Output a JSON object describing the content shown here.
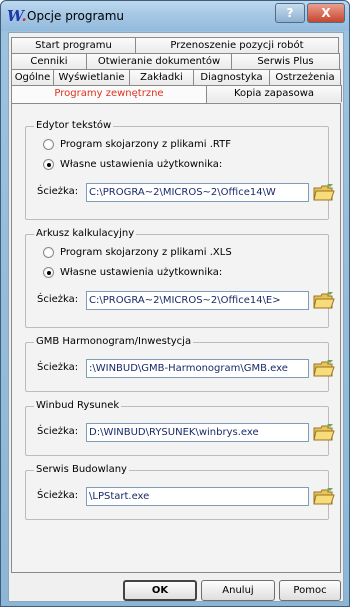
{
  "window": {
    "title": "Opcje programu",
    "help_glyph": "?",
    "close_glyph": "X"
  },
  "tabs": {
    "row1": [
      "Start programu",
      "Przenoszenie pozycji robót"
    ],
    "row2": [
      "Cenniki",
      "Otwieranie dokumentów",
      "Serwis Plus"
    ],
    "row3": [
      "Ogólne",
      "Wyświetlanie",
      "Zakładki",
      "Diagnostyka",
      "Ostrzeżenia"
    ],
    "row4": [
      "Programy zewnętrzne",
      "Kopia zapasowa"
    ],
    "active": "Programy zewnętrzne"
  },
  "groups": [
    {
      "title": "Edytor tekstów",
      "radio1": "Program skojarzony z plikami .RTF",
      "radio2": "Własne ustawienia użytkownika:",
      "path_label": "Ścieżka:",
      "path_value": "C:\\PROGRA~2\\MICROS~2\\Office14\\W"
    },
    {
      "title": "Arkusz kalkulacyjny",
      "radio1": "Program skojarzony z plikami .XLS",
      "radio2": "Własne ustawienia użytkownika:",
      "path_label": "Ścieżka:",
      "path_value": "C:\\PROGRA~2\\MICROS~2\\Office14\\E>"
    },
    {
      "title": "GMB Harmonogram/Inwestycja",
      "path_label": "Ścieżka:",
      "path_value": ":\\WINBUD\\GMB-Harmonogram\\GMB.exe"
    },
    {
      "title": "Winbud Rysunek",
      "path_label": "Ścieżka:",
      "path_value": "D:\\WINBUD\\RYSUNEK\\winbrys.exe"
    },
    {
      "title": "Serwis Budowlany",
      "path_label": "Ścieżka:",
      "path_value": "\\LPStart.exe"
    }
  ],
  "buttons": {
    "ok": "OK",
    "cancel": "Anuluj",
    "help": "Pomoc"
  },
  "colors": {
    "active_tab": "#e0301e",
    "title_bar": "#a6c8e5",
    "close_button": "#c8462f"
  }
}
